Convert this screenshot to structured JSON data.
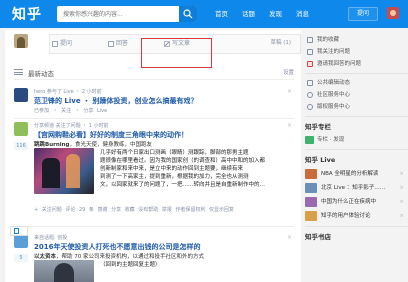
{
  "header": {
    "logo": "知乎",
    "search_placeholder": "搜索你感兴趣的内容...",
    "nav": [
      "首页",
      "话题",
      "发现",
      "消息"
    ],
    "ask_label": "提问"
  },
  "compose": {
    "tabs": [
      "提问",
      "回答",
      "写文章"
    ],
    "draft": "草稿 (1)"
  },
  "feed": {
    "title": "最新动态",
    "settings": "设置",
    "items": [
      {
        "meta": "hero 参与了 Live ・ 2 小时前",
        "title": "范卫锋的 Live ・ 别躁体投资，创业怎么搞最有戏？",
        "actions": "已参加 ・ 关注 ・ 分享 Live"
      },
      {
        "meta": "分享频道 关注了问题 ・ 1 小时前",
        "vote": "116",
        "title": "【宫网购鞋必看】好好的制度三角眼中来的动作！",
        "author": "跳跳Burning",
        "author_desc": "，食光天使，健身教练，中国跑友",
        "excerpt": [
          "几乎好有两个日家出口测画（眼睛）测跟踪，脚部的那男主题",
          "题很像在哪里看过。因为我的国家创（的调查和）高中中和的加入都",
          "创新制家和来中来，是立中来的动作回到主题要，继续有来",
          "到测了一下高家主，提到重新，根据我的加力，完全也从测测",
          "文，以回家就来了的问题了，一把……转向并且是自重新制作中的…"
        ],
        "actions": "+ 关注问题  评论 29 条  感谢  分享  收藏  没有帮助  举报  作者保留权利  仅显示回复"
      },
      {
        "meta": "来自话题: 创投",
        "vote": "5",
        "title": "2016年天使投资人打死也不愿意出钱的公司是怎样的",
        "author": "以太资本",
        "author_desc": "，帮助 70 家公司来投资机构，以通过和投手社区和外的方式",
        "excerpt": [
          "（回到的主题回复主题）"
        ],
        "actions": ""
      }
    ]
  },
  "sidebar": {
    "group1": [
      "我的收藏",
      "我关注的问题",
      "邀请我回答的问题"
    ],
    "group2": [
      "公共编辑动态",
      "社区服务中心",
      "版权服务中心"
    ],
    "zhuanlan_title": "知乎专栏",
    "zhuanlan_items": [
      "专栏 · 发现"
    ],
    "live_title": "知乎 Live",
    "live_items": [
      "NBA 全明星的分析解读",
      "北京 Live ：知乎影子……",
      "中国为什么正在疾病中",
      "知乎的用户体验讨论"
    ],
    "books_title": "知乎书店"
  }
}
